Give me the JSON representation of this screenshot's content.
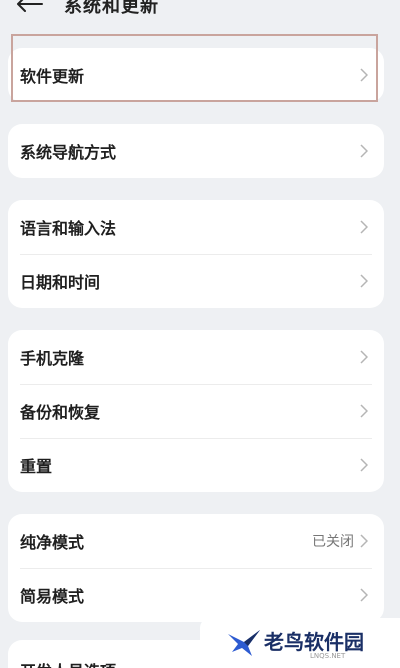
{
  "header": {
    "title": "系统和更新"
  },
  "cards": [
    {
      "rows": [
        {
          "label": "软件更新"
        }
      ]
    },
    {
      "rows": [
        {
          "label": "系统导航方式"
        }
      ]
    },
    {
      "rows": [
        {
          "label": "语言和输入法"
        },
        {
          "label": "日期和时间"
        }
      ]
    },
    {
      "rows": [
        {
          "label": "手机克隆"
        },
        {
          "label": "备份和恢复"
        },
        {
          "label": "重置"
        }
      ]
    },
    {
      "rows": [
        {
          "label": "纯净模式",
          "value": "已关闭"
        },
        {
          "label": "简易模式"
        }
      ]
    },
    {
      "rows": [
        {
          "label": "开发人员选项"
        }
      ]
    }
  ],
  "watermark": {
    "text": "老鸟软件园",
    "sub": "LNQS.NET"
  },
  "colors": {
    "background": "#eef0f3",
    "highlight_border": "#c9a49d",
    "watermark_text": "#1a2f66"
  }
}
